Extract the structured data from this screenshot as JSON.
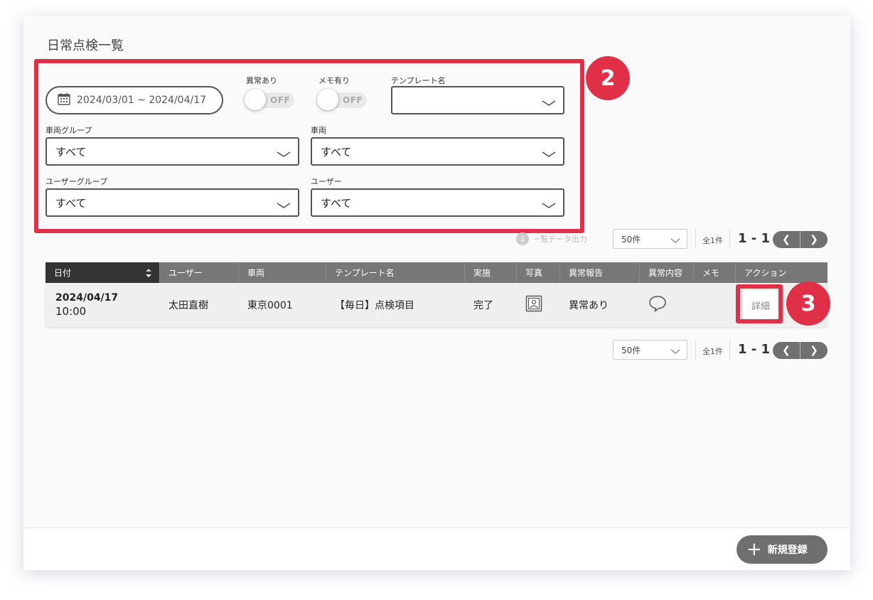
{
  "page": {
    "title": "日常点検一覧"
  },
  "filters": {
    "date_range": "2024/03/01 ~ 2024/04/17",
    "anomaly": {
      "label": "異常あり",
      "state": "OFF"
    },
    "memo": {
      "label": "メモ有り",
      "state": "OFF"
    },
    "template": {
      "label": "テンプレート名",
      "value": ""
    },
    "vehicle_group": {
      "label": "車両グループ",
      "value": "すべて"
    },
    "vehicle": {
      "label": "車両",
      "value": "すべて"
    },
    "user_group": {
      "label": "ユーザーグループ",
      "value": "すべて"
    },
    "user": {
      "label": "ユーザー",
      "value": "すべて"
    }
  },
  "annotations": {
    "badge_filters": "2",
    "badge_detail": "3"
  },
  "toolbar": {
    "export_label": "一覧データ出力"
  },
  "pagination": {
    "per_page": "50件",
    "total": "全1件",
    "range": "1 - 1",
    "prev": "❮",
    "next": "❯"
  },
  "table": {
    "columns": [
      "日付",
      "ユーザー",
      "車両",
      "テンプレート名",
      "実施",
      "写真",
      "異常報告",
      "異常内容",
      "メモ",
      "アクション"
    ],
    "rows": [
      {
        "date": "2024/04/17",
        "time": "10:00",
        "user": "太田直樹",
        "vehicle": "東京0001",
        "template": "【毎日】点検項目",
        "status": "完了",
        "photo_icon": "photo-icon",
        "anomaly_report": "異常あり",
        "anomaly_detail_icon": "speech-bubble-icon",
        "memo": "",
        "action": "詳細"
      }
    ]
  },
  "footer": {
    "new_button": "新規登録"
  },
  "colors": {
    "highlight": "#e03048",
    "header_dark": "#333333",
    "header": "#777777",
    "button": "#6f6f6f"
  }
}
